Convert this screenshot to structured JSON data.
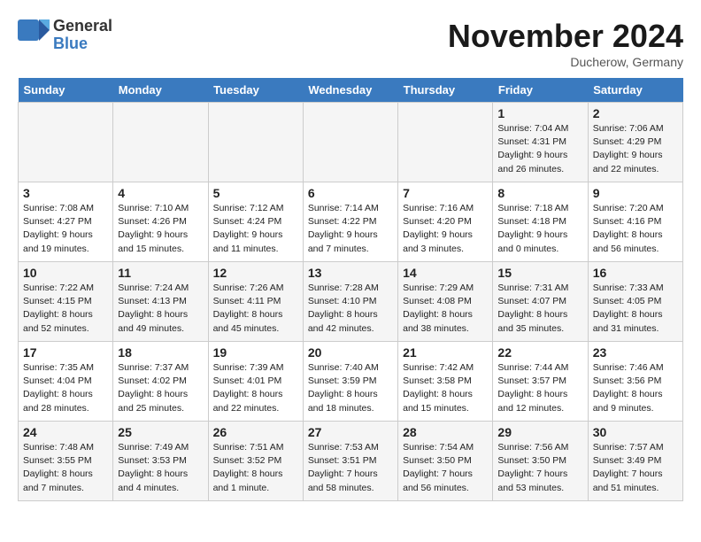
{
  "header": {
    "logo_line1": "General",
    "logo_line2": "Blue",
    "month_title": "November 2024",
    "subtitle": "Ducherow, Germany"
  },
  "calendar": {
    "days_of_week": [
      "Sunday",
      "Monday",
      "Tuesday",
      "Wednesday",
      "Thursday",
      "Friday",
      "Saturday"
    ],
    "weeks": [
      [
        {
          "day": "",
          "info": ""
        },
        {
          "day": "",
          "info": ""
        },
        {
          "day": "",
          "info": ""
        },
        {
          "day": "",
          "info": ""
        },
        {
          "day": "",
          "info": ""
        },
        {
          "day": "1",
          "info": "Sunrise: 7:04 AM\nSunset: 4:31 PM\nDaylight: 9 hours and 26 minutes."
        },
        {
          "day": "2",
          "info": "Sunrise: 7:06 AM\nSunset: 4:29 PM\nDaylight: 9 hours and 22 minutes."
        }
      ],
      [
        {
          "day": "3",
          "info": "Sunrise: 7:08 AM\nSunset: 4:27 PM\nDaylight: 9 hours and 19 minutes."
        },
        {
          "day": "4",
          "info": "Sunrise: 7:10 AM\nSunset: 4:26 PM\nDaylight: 9 hours and 15 minutes."
        },
        {
          "day": "5",
          "info": "Sunrise: 7:12 AM\nSunset: 4:24 PM\nDaylight: 9 hours and 11 minutes."
        },
        {
          "day": "6",
          "info": "Sunrise: 7:14 AM\nSunset: 4:22 PM\nDaylight: 9 hours and 7 minutes."
        },
        {
          "day": "7",
          "info": "Sunrise: 7:16 AM\nSunset: 4:20 PM\nDaylight: 9 hours and 3 minutes."
        },
        {
          "day": "8",
          "info": "Sunrise: 7:18 AM\nSunset: 4:18 PM\nDaylight: 9 hours and 0 minutes."
        },
        {
          "day": "9",
          "info": "Sunrise: 7:20 AM\nSunset: 4:16 PM\nDaylight: 8 hours and 56 minutes."
        }
      ],
      [
        {
          "day": "10",
          "info": "Sunrise: 7:22 AM\nSunset: 4:15 PM\nDaylight: 8 hours and 52 minutes."
        },
        {
          "day": "11",
          "info": "Sunrise: 7:24 AM\nSunset: 4:13 PM\nDaylight: 8 hours and 49 minutes."
        },
        {
          "day": "12",
          "info": "Sunrise: 7:26 AM\nSunset: 4:11 PM\nDaylight: 8 hours and 45 minutes."
        },
        {
          "day": "13",
          "info": "Sunrise: 7:28 AM\nSunset: 4:10 PM\nDaylight: 8 hours and 42 minutes."
        },
        {
          "day": "14",
          "info": "Sunrise: 7:29 AM\nSunset: 4:08 PM\nDaylight: 8 hours and 38 minutes."
        },
        {
          "day": "15",
          "info": "Sunrise: 7:31 AM\nSunset: 4:07 PM\nDaylight: 8 hours and 35 minutes."
        },
        {
          "day": "16",
          "info": "Sunrise: 7:33 AM\nSunset: 4:05 PM\nDaylight: 8 hours and 31 minutes."
        }
      ],
      [
        {
          "day": "17",
          "info": "Sunrise: 7:35 AM\nSunset: 4:04 PM\nDaylight: 8 hours and 28 minutes."
        },
        {
          "day": "18",
          "info": "Sunrise: 7:37 AM\nSunset: 4:02 PM\nDaylight: 8 hours and 25 minutes."
        },
        {
          "day": "19",
          "info": "Sunrise: 7:39 AM\nSunset: 4:01 PM\nDaylight: 8 hours and 22 minutes."
        },
        {
          "day": "20",
          "info": "Sunrise: 7:40 AM\nSunset: 3:59 PM\nDaylight: 8 hours and 18 minutes."
        },
        {
          "day": "21",
          "info": "Sunrise: 7:42 AM\nSunset: 3:58 PM\nDaylight: 8 hours and 15 minutes."
        },
        {
          "day": "22",
          "info": "Sunrise: 7:44 AM\nSunset: 3:57 PM\nDaylight: 8 hours and 12 minutes."
        },
        {
          "day": "23",
          "info": "Sunrise: 7:46 AM\nSunset: 3:56 PM\nDaylight: 8 hours and 9 minutes."
        }
      ],
      [
        {
          "day": "24",
          "info": "Sunrise: 7:48 AM\nSunset: 3:55 PM\nDaylight: 8 hours and 7 minutes."
        },
        {
          "day": "25",
          "info": "Sunrise: 7:49 AM\nSunset: 3:53 PM\nDaylight: 8 hours and 4 minutes."
        },
        {
          "day": "26",
          "info": "Sunrise: 7:51 AM\nSunset: 3:52 PM\nDaylight: 8 hours and 1 minute."
        },
        {
          "day": "27",
          "info": "Sunrise: 7:53 AM\nSunset: 3:51 PM\nDaylight: 7 hours and 58 minutes."
        },
        {
          "day": "28",
          "info": "Sunrise: 7:54 AM\nSunset: 3:50 PM\nDaylight: 7 hours and 56 minutes."
        },
        {
          "day": "29",
          "info": "Sunrise: 7:56 AM\nSunset: 3:50 PM\nDaylight: 7 hours and 53 minutes."
        },
        {
          "day": "30",
          "info": "Sunrise: 7:57 AM\nSunset: 3:49 PM\nDaylight: 7 hours and 51 minutes."
        }
      ]
    ]
  }
}
